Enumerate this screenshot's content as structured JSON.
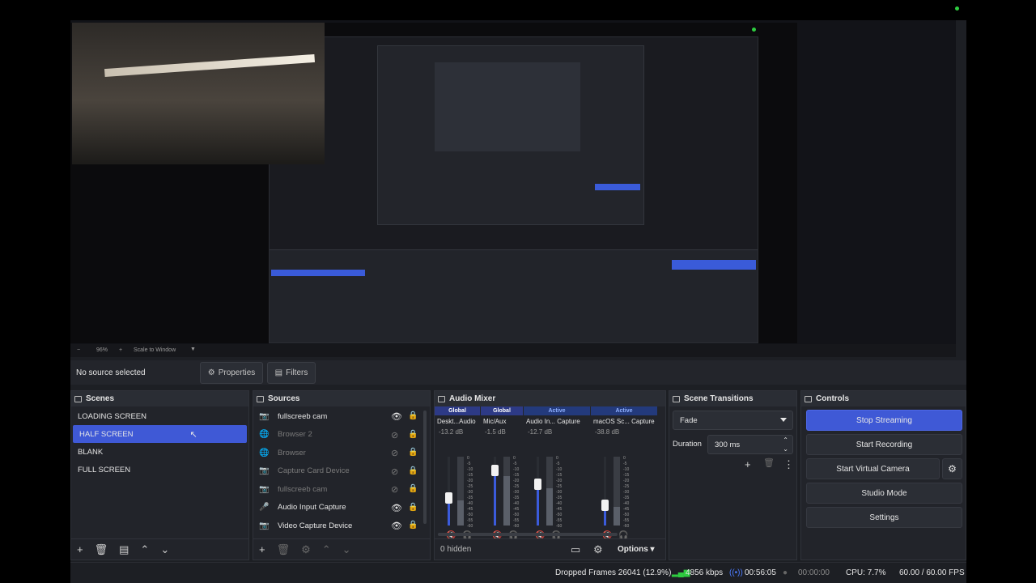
{
  "preview": {
    "zoom": "96%",
    "zoom_mode": "Scale to Window"
  },
  "properties_bar": {
    "no_source": "No source selected",
    "properties_label": "Properties",
    "filters_label": "Filters"
  },
  "scenes": {
    "title": "Scenes",
    "items": [
      {
        "label": "LOADING SCREEN"
      },
      {
        "label": "HALF SCREEN",
        "selected": true
      },
      {
        "label": "BLANK"
      },
      {
        "label": "FULL SCREEN"
      }
    ]
  },
  "sources": {
    "title": "Sources",
    "items": [
      {
        "label": "fullscreeb cam",
        "icon": "camera-icon",
        "visible": true
      },
      {
        "label": "Browser 2",
        "icon": "globe-icon",
        "visible": false
      },
      {
        "label": "Browser",
        "icon": "globe-icon",
        "visible": false
      },
      {
        "label": "Capture Card Device",
        "icon": "camera-icon",
        "visible": false
      },
      {
        "label": "fullscreeb cam",
        "icon": "camera-icon",
        "visible": false
      },
      {
        "label": "Audio Input Capture",
        "icon": "microphone-icon",
        "visible": true
      },
      {
        "label": "Video Capture Device",
        "icon": "camera-icon",
        "visible": true
      }
    ]
  },
  "mixer": {
    "title": "Audio Mixer",
    "channels": [
      {
        "header": "Global",
        "name": "Deskt...Audio",
        "db": "-13.2 dB",
        "fader": 0.4
      },
      {
        "header": "Global",
        "name": "Mic/Aux",
        "db": "-1.5 dB",
        "fader": 0.8
      },
      {
        "header": "Active",
        "name": "Audio In... Capture",
        "db": "-12.7 dB",
        "fader": 0.6
      },
      {
        "header": "Active",
        "name": "macOS Sc... Capture",
        "db": "-38.8 dB",
        "fader": 0.3
      }
    ],
    "scale": [
      "0",
      "-5",
      "-10",
      "-15",
      "-20",
      "-25",
      "-30",
      "-35",
      "-40",
      "-45",
      "-50",
      "-55",
      "-60"
    ],
    "hidden_label": "0 hidden",
    "options_label": "Options"
  },
  "transitions": {
    "title": "Scene Transitions",
    "selected": "Fade",
    "duration_label": "Duration",
    "duration_value": "300 ms"
  },
  "controls": {
    "title": "Controls",
    "stop_streaming": "Stop Streaming",
    "start_recording": "Start Recording",
    "start_virtual_camera": "Start Virtual Camera",
    "studio_mode": "Studio Mode",
    "settings": "Settings"
  },
  "status": {
    "dropped_frames": "Dropped Frames 26041 (12.9%)",
    "bitrate": "4856 kbps",
    "stream_time": "00:56:05",
    "record_time": "00:00:00",
    "cpu": "CPU: 7.7%",
    "fps": "60.00 / 60.00 FPS"
  },
  "colors": {
    "accent": "#3f59d6",
    "background": "#1d1f24",
    "dock": "#22242a",
    "mute": "#e03b3b"
  }
}
